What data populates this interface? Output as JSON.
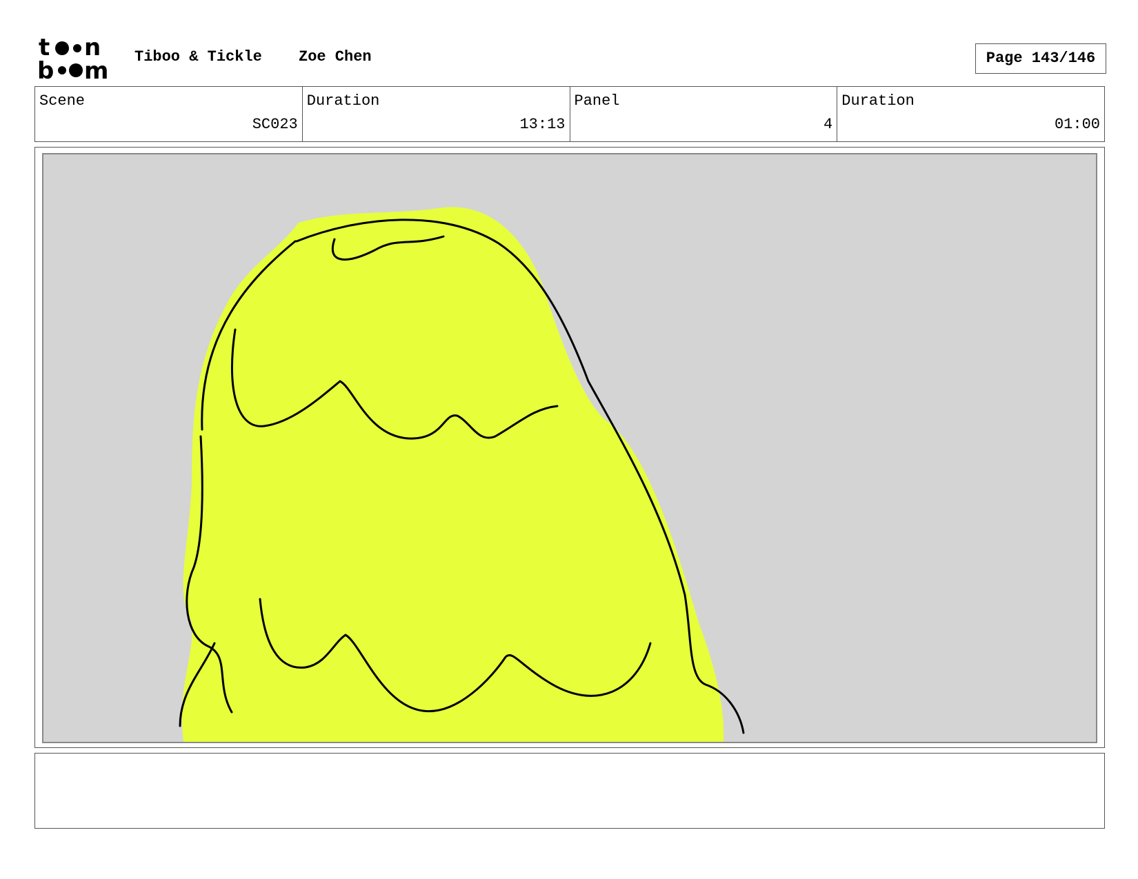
{
  "header": {
    "logo": "toon boom",
    "project": "Tiboo & Tickle",
    "author": "Zoe Chen",
    "page": "Page 143/146"
  },
  "info": [
    {
      "label": "Scene",
      "value": "SC023"
    },
    {
      "label": "Duration",
      "value": "13:13"
    },
    {
      "label": "Panel",
      "value": "4"
    },
    {
      "label": "Duration",
      "value": "01:00"
    }
  ],
  "colors": {
    "hair": "#e6ff3a",
    "background": "#d4d4d4"
  }
}
